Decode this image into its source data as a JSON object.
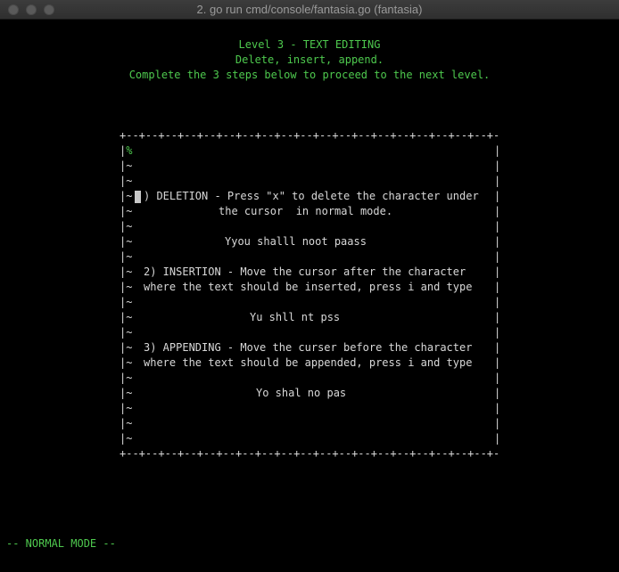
{
  "window": {
    "title": "2. go run cmd/console/fantasia.go (fantasia)"
  },
  "header": {
    "level_title": "Level 3 - TEXT EDITING",
    "subtitle": "Delete, insert, append.",
    "instruction": "Complete the 3 steps below to proceed to the next level."
  },
  "box": {
    "top_border": "+--+--+--+--+--+--+--+--+--+--+--+--+--+--+--+--+--+--+--+--+--+--+--+--+--+--+--+--+--+--+--+--+--+--+--+--+--+--+--+--+--+--+--+--+--+--+",
    "bottom_border": "+--+--+--+--+--+--+--+--+--+--+--+--+--+--+--+--+--+--+--+--+--+--+--+--+--+--+--+--+--+--+--+--+--+--+--+--+--+--+--+--+--+--+--+--+--+--+",
    "first_row_marker": "%",
    "tilde": "~",
    "side": "|",
    "steps": {
      "deletion_line1": ") DELETION - Press \"x\" to delete the character under",
      "deletion_line2": "the cursor  in normal mode.",
      "deletion_exercise": "Yyou shalll noot paass",
      "insertion_line1": "2) INSERTION - Move the cursor after the character",
      "insertion_line2": "where the text should be inserted, press i and type",
      "insertion_exercise": "Yu shll nt pss",
      "appending_line1": "3) APPENDING - Move the curser before the character",
      "appending_line2": "where the text should be appended, press i and type",
      "appending_exercise": "Yo shal no pas"
    }
  },
  "status": {
    "mode": "-- NORMAL MODE --"
  },
  "colors": {
    "accent_green": "#4ec94e",
    "text": "#d8d8d8",
    "background": "#000000"
  }
}
